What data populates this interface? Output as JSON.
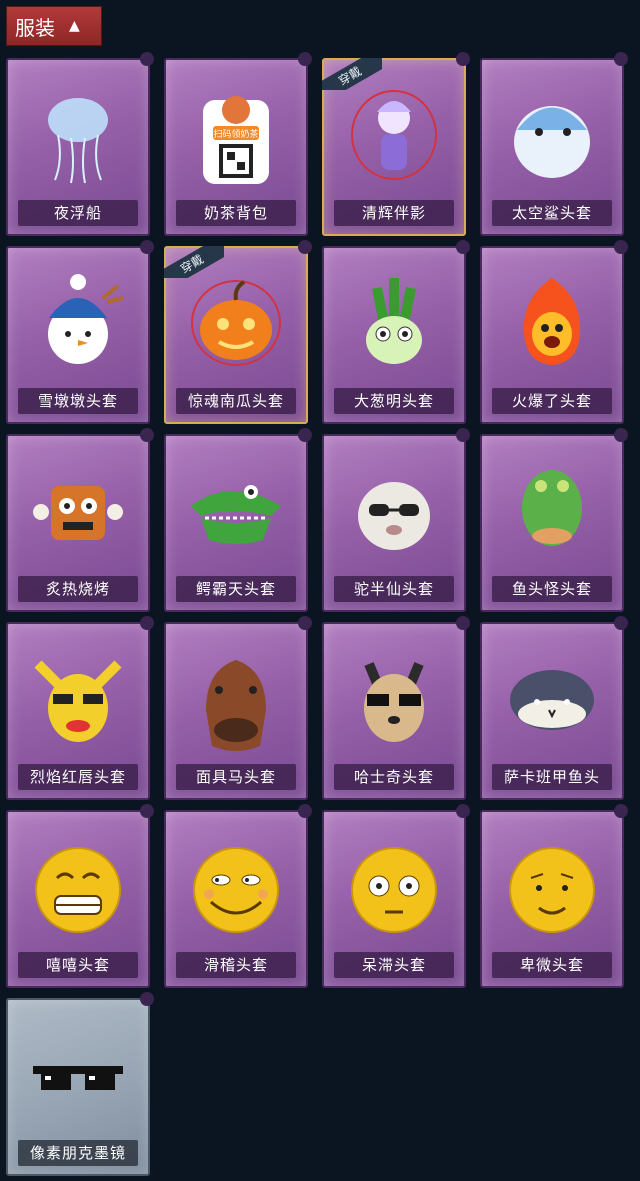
{
  "header": {
    "title": "服装",
    "chevron": "chevron-up-icon"
  },
  "equipped_badge": "穿戴",
  "items": [
    {
      "label": "夜浮船",
      "icon": "jellyfish-ship-icon",
      "equipped": false,
      "tier": "purple"
    },
    {
      "label": "奶茶背包",
      "icon": "milk-tea-backpack-icon",
      "equipped": false,
      "tier": "purple",
      "art_text": "扫码领奶茶"
    },
    {
      "label": "清辉伴影",
      "icon": "companion-figure-icon",
      "equipped": true,
      "tier": "purple"
    },
    {
      "label": "太空鲨头套",
      "icon": "space-shark-head-icon",
      "equipped": false,
      "tier": "purple"
    },
    {
      "label": "雪墩墩头套",
      "icon": "snowman-head-icon",
      "equipped": false,
      "tier": "purple"
    },
    {
      "label": "惊魂南瓜头套",
      "icon": "pumpkin-head-icon",
      "equipped": true,
      "tier": "purple"
    },
    {
      "label": "大葱明头套",
      "icon": "scallion-head-icon",
      "equipped": false,
      "tier": "purple"
    },
    {
      "label": "火爆了头套",
      "icon": "fire-head-icon",
      "equipped": false,
      "tier": "purple"
    },
    {
      "label": "炙热烧烤",
      "icon": "bbq-meat-icon",
      "equipped": false,
      "tier": "purple"
    },
    {
      "label": "鳄霸天头套",
      "icon": "crocodile-head-icon",
      "equipped": false,
      "tier": "purple"
    },
    {
      "label": "驼半仙头套",
      "icon": "alpaca-head-icon",
      "equipped": false,
      "tier": "purple"
    },
    {
      "label": "鱼头怪头套",
      "icon": "fish-head-icon",
      "equipped": false,
      "tier": "purple"
    },
    {
      "label": "烈焰红唇头套",
      "icon": "yellow-mascot-head-icon",
      "equipped": false,
      "tier": "purple"
    },
    {
      "label": "面具马头套",
      "icon": "horse-mask-icon",
      "equipped": false,
      "tier": "purple"
    },
    {
      "label": "哈士奇头套",
      "icon": "husky-head-icon",
      "equipped": false,
      "tier": "purple"
    },
    {
      "label": "萨卡班甲鱼头",
      "icon": "sacabambaspis-head-icon",
      "equipped": false,
      "tier": "purple"
    },
    {
      "label": "嘻嘻头套",
      "icon": "grin-emoji-head-icon",
      "equipped": false,
      "tier": "purple"
    },
    {
      "label": "滑稽头套",
      "icon": "funny-emoji-head-icon",
      "equipped": false,
      "tier": "purple"
    },
    {
      "label": "呆滞头套",
      "icon": "dazed-emoji-head-icon",
      "equipped": false,
      "tier": "purple"
    },
    {
      "label": "卑微头套",
      "icon": "humble-emoji-head-icon",
      "equipped": false,
      "tier": "purple"
    },
    {
      "label": "像素朋克墨镜",
      "icon": "pixel-sunglasses-icon",
      "equipped": false,
      "tier": "grey"
    }
  ]
}
